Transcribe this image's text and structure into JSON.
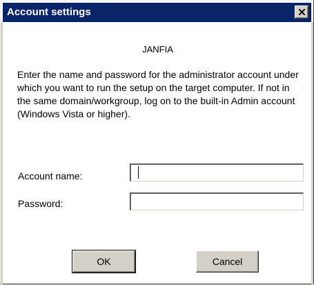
{
  "dialog": {
    "title": "Account settings",
    "close_glyph": "close-icon"
  },
  "app_name": "JANFIA",
  "instructions": "Enter the name and password for the administrator account under which you want to run the setup on the target computer. If not in the same domain/workgroup, log on to the built-in Admin account (Windows Vista or higher).",
  "form": {
    "account_name_label": "Account name:",
    "account_name_value": "",
    "password_label": "Password:",
    "password_value": ""
  },
  "buttons": {
    "ok_label": "OK",
    "cancel_label": "Cancel"
  },
  "colors": {
    "titlebar": "#0a246a",
    "dialog_bg": "#ffffff",
    "button_face": "#d4d0c8"
  }
}
